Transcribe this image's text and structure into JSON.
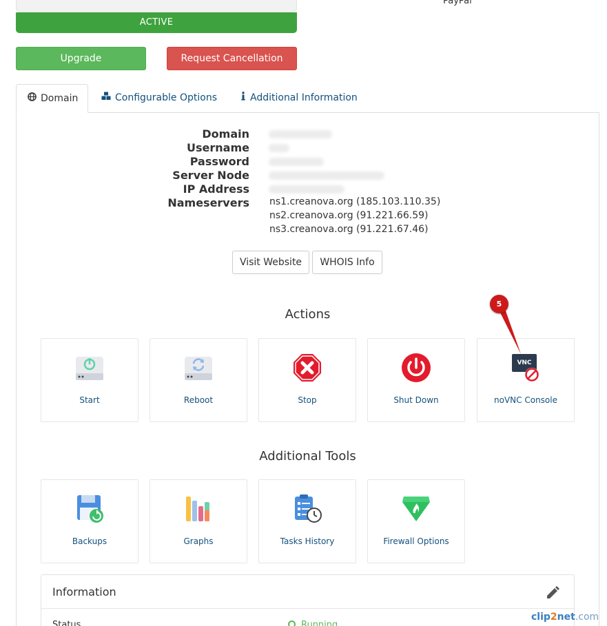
{
  "top": {
    "status": "ACTIVE",
    "payment_method": "PayPal",
    "upgrade_label": "Upgrade",
    "cancel_label": "Request Cancellation"
  },
  "tabs": [
    {
      "label": "Domain",
      "icon": "globe-icon",
      "active": true
    },
    {
      "label": "Configurable Options",
      "icon": "cubes-icon",
      "active": false
    },
    {
      "label": "Additional Information",
      "icon": "info-icon",
      "active": false
    }
  ],
  "details": {
    "labels": [
      "Domain",
      "Username",
      "Password",
      "Server Node",
      "IP Address",
      "Nameservers"
    ],
    "nameservers": [
      "ns1.creanova.org (185.103.110.35)",
      "ns2.creanova.org (91.221.66.59)",
      "ns3.creanova.org (91.221.67.46)"
    ]
  },
  "buttons": {
    "visit_website": "Visit Website",
    "whois_info": "WHOIS Info"
  },
  "actions": {
    "title": "Actions",
    "items": [
      {
        "label": "Start",
        "icon": "server-power-icon"
      },
      {
        "label": "Reboot",
        "icon": "server-reboot-icon"
      },
      {
        "label": "Stop",
        "icon": "stop-icon"
      },
      {
        "label": "Shut Down",
        "icon": "power-icon"
      },
      {
        "label": "noVNC Console",
        "icon": "vnc-disabled-icon"
      }
    ]
  },
  "tools": {
    "title": "Additional Tools",
    "items": [
      {
        "label": "Backups",
        "icon": "backup-icon"
      },
      {
        "label": "Graphs",
        "icon": "graphs-icon"
      },
      {
        "label": "Tasks History",
        "icon": "tasks-history-icon"
      },
      {
        "label": "Firewall Options",
        "icon": "firewall-icon"
      }
    ]
  },
  "annotation": {
    "number": "5"
  },
  "vnc_badge": "VNC",
  "information": {
    "title": "Information",
    "status_label": "Status",
    "status_value": "Running"
  },
  "watermark": {
    "part1": "clip",
    "part2": "2",
    "part3": "net",
    "part4": ".com"
  },
  "colors": {
    "active_green": "#3ea33e",
    "upgrade_green": "#5cb85c",
    "cancel_red": "#d9534f",
    "link_blue": "#14507c",
    "marker_red": "#cc1a1a"
  }
}
